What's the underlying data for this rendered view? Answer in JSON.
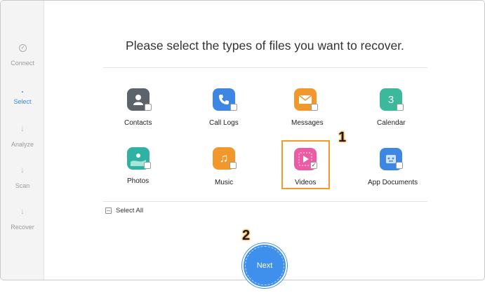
{
  "sidebar": {
    "steps": [
      {
        "label": "Connect"
      },
      {
        "label": "Select"
      },
      {
        "label": "Analyze"
      },
      {
        "label": "Scan"
      },
      {
        "label": "Recover"
      }
    ]
  },
  "main": {
    "title": "Please select the types of files you want to recover.",
    "file_types": [
      {
        "label": "Contacts",
        "icon": "contacts-icon",
        "color": "#5d636b",
        "checked": false
      },
      {
        "label": "Call Logs",
        "icon": "phone-icon",
        "color": "#3e86e3",
        "checked": false
      },
      {
        "label": "Messages",
        "icon": "envelope-icon",
        "color": "#f2972c",
        "checked": false
      },
      {
        "label": "Calendar",
        "icon": "calendar-icon",
        "color": "#3bb99a",
        "checked": false
      },
      {
        "label": "Photos",
        "icon": "photos-icon",
        "color": "#2fb2a3",
        "checked": false
      },
      {
        "label": "Music",
        "icon": "music-icon",
        "color": "#f2972c",
        "checked": false
      },
      {
        "label": "Videos",
        "icon": "video-icon",
        "color": "#ee5aa4",
        "checked": true
      },
      {
        "label": "App Documents",
        "icon": "app-documents-icon",
        "color": "#3e86e3",
        "checked": false
      }
    ],
    "select_all_label": "Select All",
    "next_label": "Next",
    "calendar_day": "3"
  },
  "annotations": {
    "step_one": "1",
    "step_two": "2"
  }
}
